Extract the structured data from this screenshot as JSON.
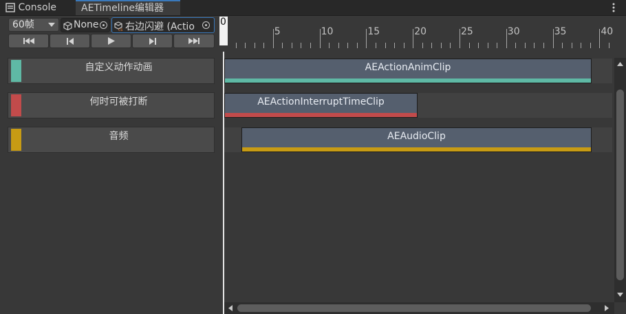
{
  "tabs": [
    {
      "label": "Console",
      "icon": "console-icon"
    },
    {
      "label": "AETimeline编辑器",
      "icon": null
    }
  ],
  "toolbar": {
    "fps_select": "60帧",
    "object_field_1": "None",
    "object_field_2": "右边闪避 (Actio",
    "transport_buttons": [
      "go-to-start-icon",
      "previous-frame-icon",
      "play-icon",
      "next-frame-icon",
      "go-to-end-icon"
    ]
  },
  "ruler": {
    "playhead_label": "0",
    "tick_labels": [
      "0",
      "5",
      "10",
      "15",
      "20",
      "25",
      "30",
      "35",
      "40"
    ],
    "tick_values": [
      0,
      5,
      10,
      15,
      20,
      25,
      30,
      35,
      40
    ]
  },
  "tracks": [
    {
      "name": "自定义动作动画",
      "color": "#5fb9a5",
      "clip": {
        "label": "AEActionAnimClip",
        "color": "#5fb9a5"
      }
    },
    {
      "name": "何时可被打断",
      "color": "#c24b4b",
      "clip": {
        "label": "AEActionInterruptTimeClip",
        "color": "#c24b4b"
      }
    },
    {
      "name": "音频",
      "color": "#c79b14",
      "clip": {
        "label": "AEAudioClip",
        "color": "#c79b14"
      }
    }
  ],
  "colors": {
    "accent": "#3a79bb",
    "background": "#383838",
    "clip_body": "#555f6e"
  }
}
